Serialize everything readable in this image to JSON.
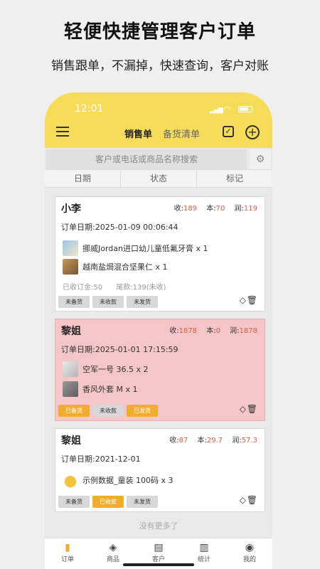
{
  "promo": {
    "title": "轻便快捷管理客户订单",
    "subtitle": "销售跟单，不漏掉，快速查询，客户对账"
  },
  "status_bar": {
    "time": "12:01"
  },
  "header": {
    "tab_active": "销售单",
    "tab_other": "备货清单"
  },
  "search": {
    "placeholder": "客户或电话或商品名称搜索"
  },
  "filters": [
    "日期",
    "状态",
    "标记"
  ],
  "colors": {
    "accent": "#f7dc5a",
    "button_orange": "#f2ad2f",
    "number_red": "#e55a3c",
    "pink_card": "#f5c6c9"
  },
  "orders": [
    {
      "customer": "小李",
      "received_label": "收:",
      "received": "189",
      "cost_label": "本:",
      "cost": "70",
      "profit_label": "润:",
      "profit": "119",
      "date": "订单日期:2025-01-09 00:06:44",
      "items": [
        {
          "name": "挪威Jordan进口幼儿童低氟牙膏 x 1",
          "thumb": "toothpaste-thumb"
        },
        {
          "name": "越南盐焗混合坚果仁 x 1",
          "thumb": "nuts-thumb"
        }
      ],
      "deposit": "已收订金:50",
      "balance": "尾款:139(未收)",
      "buttons": [
        "未备货",
        "未收款",
        "未发货"
      ]
    },
    {
      "customer": "黎姐",
      "received_label": "收:",
      "received": "1878",
      "cost_label": "本:",
      "cost": "0",
      "profit_label": "润:",
      "profit": "1878",
      "date": "订单日期:2025-01-01 17:15:59",
      "items": [
        {
          "name": "空军一号 36.5 x 2",
          "thumb": "sneaker-thumb"
        },
        {
          "name": "香风外套 M x 1",
          "thumb": "jacket-thumb"
        }
      ],
      "buttons": [
        "已备货",
        "未收款",
        "已发货"
      ]
    },
    {
      "customer": "黎姐",
      "received_label": "收:",
      "received": "87",
      "cost_label": "本:",
      "cost": "29.7",
      "profit_label": "润:",
      "profit": "57.3",
      "date": "订单日期:2021-12-01",
      "items": [
        {
          "name": "示例数据_童装 100码 x 3",
          "thumb": "bell-thumb"
        }
      ],
      "buttons": [
        "未备货",
        "已收款",
        "未发货"
      ]
    }
  ],
  "no_more": "没有更多了",
  "nav": [
    "订单",
    "商品",
    "客户",
    "统计",
    "我的"
  ]
}
